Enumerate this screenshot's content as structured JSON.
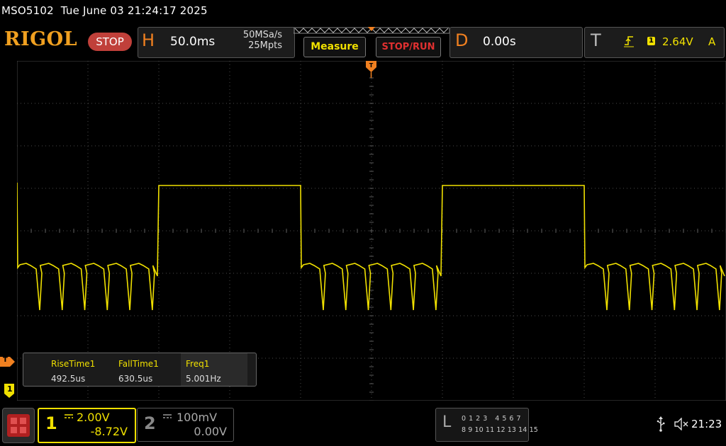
{
  "status": {
    "model": "MSO5102",
    "datetime": "Tue June 03 21:24:17 2025"
  },
  "header": {
    "logo": "RIGOL",
    "run_state": "STOP",
    "horizontal": {
      "letter": "H",
      "timebase": "50.0ms",
      "sample_rate": "50MSa/s",
      "memory_depth": "25Mpts"
    },
    "measure_label": "Measure",
    "stop_run_label": "STOP/RUN",
    "delay": {
      "letter": "D",
      "value": "0.00s"
    },
    "trigger": {
      "letter": "T",
      "source": "1",
      "level": "2.64V",
      "mode": "A",
      "slope_icon": "rising-edge-icon"
    }
  },
  "measurements": [
    {
      "name": "RiseTime1",
      "value": "492.5us"
    },
    {
      "name": "FallTime1",
      "value": "630.5us"
    },
    {
      "name": "Freq1",
      "value": "5.001Hz"
    }
  ],
  "markers": {
    "trigger_level": "T",
    "ch1": "1"
  },
  "channels": [
    {
      "number": "1",
      "scale": "2.00V",
      "offset": "-8.72V",
      "color": "#f0e000",
      "active": true
    },
    {
      "number": "2",
      "scale": "100mV",
      "offset": "0.00V",
      "color": "#888888",
      "active": false
    }
  ],
  "logic_analyzer": {
    "letter": "L",
    "row1": "0 1 2 3   4 5 6 7",
    "row2": "8 9 10 11 12 13 14 15"
  },
  "system": {
    "clock": "21:23",
    "usb_icon": "usb-icon",
    "sound_icon": "speaker-muted-icon"
  },
  "colors": {
    "ch1": "#f0e000",
    "accent": "#f08020",
    "grid": "#3a3a3a",
    "stop": "#c0403a"
  },
  "waveform": {
    "channel": "1",
    "shape": "square wave with low-level ringing dips",
    "frequency_hz": 5.001,
    "high_level_v": 2.0,
    "low_level_v": -2.0,
    "dips_per_low_period": 6
  }
}
